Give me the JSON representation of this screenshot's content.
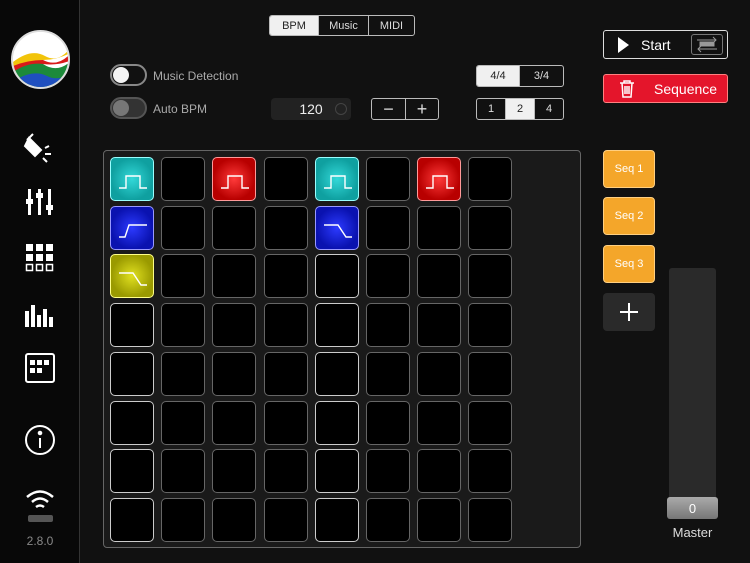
{
  "sidebar": {
    "icons": [
      "paint-bucket-icon",
      "sliders-icon",
      "grid-icon",
      "equalizer-icon",
      "sequence-icon",
      "info-icon",
      "wifi-icon"
    ],
    "version": "2.8.0"
  },
  "mode_tabs": [
    {
      "label": "BPM",
      "active": true
    },
    {
      "label": "Music",
      "active": false
    },
    {
      "label": "MIDI",
      "active": false
    }
  ],
  "music_detection": {
    "label": "Music Detection",
    "on": false
  },
  "auto_bpm": {
    "label": "Auto BPM",
    "on": false
  },
  "bpm_value": "120",
  "stepper": {
    "minus": "−",
    "plus": "+"
  },
  "time_signature": [
    {
      "label": "4/4",
      "active": true
    },
    {
      "label": "3/4",
      "active": false
    }
  ],
  "multiplier": [
    {
      "label": "1",
      "active": false
    },
    {
      "label": "2",
      "active": true
    },
    {
      "label": "4",
      "active": false
    }
  ],
  "start_button": {
    "label": "Start"
  },
  "sequence_button": {
    "label": "Sequence"
  },
  "sequences": [
    {
      "label": "Seq 1"
    },
    {
      "label": "Seq 2"
    },
    {
      "label": "Seq 3"
    }
  ],
  "master": {
    "value": "0",
    "label": "Master"
  },
  "grid": {
    "rows": [
      [
        "cyan-pulse",
        "",
        "red-pulse",
        "",
        "cyan-pulse-b",
        "",
        "red-pulse",
        ""
      ],
      [
        "blue-rise",
        "",
        "",
        "",
        "blue-fall-b",
        "",
        "",
        ""
      ],
      [
        "yellow-fall",
        "",
        "",
        "",
        "b",
        "",
        "",
        ""
      ],
      [
        "b",
        "",
        "",
        "",
        "b",
        "",
        "",
        ""
      ],
      [
        "b",
        "",
        "",
        "",
        "b",
        "",
        "",
        ""
      ],
      [
        "b",
        "",
        "",
        "",
        "b",
        "",
        "",
        ""
      ],
      [
        "b",
        "",
        "",
        "",
        "b",
        "",
        "",
        ""
      ],
      [
        "b",
        "",
        "",
        "",
        "b",
        "",
        "",
        ""
      ]
    ]
  },
  "colors": {
    "accent_red": "#e4152b",
    "seq_orange": "#f4a62a",
    "pad_cyan": "#1fc0c0",
    "pad_red": "#e01010",
    "pad_blue": "#1a20e0",
    "pad_yellow": "#c8c800"
  }
}
